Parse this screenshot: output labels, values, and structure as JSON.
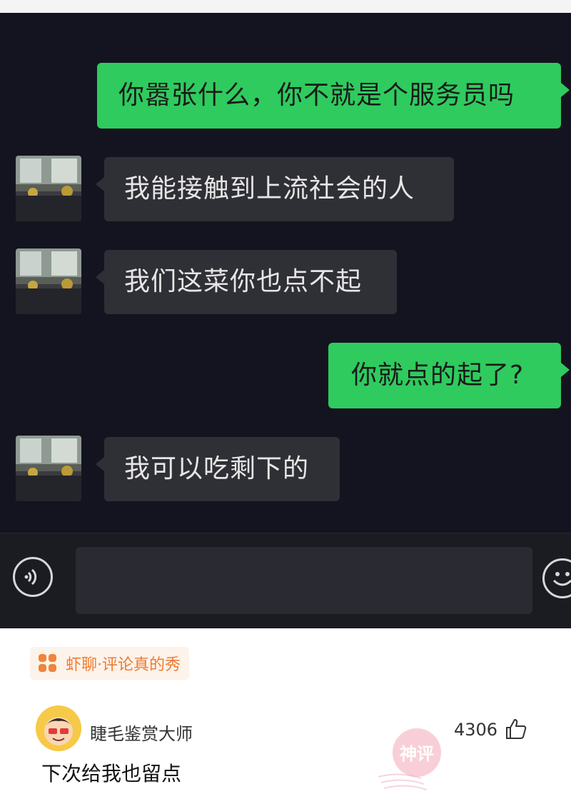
{
  "chat": {
    "messages": [
      {
        "side": "out",
        "text": "你嚣张什么，你不就是个服务员吗"
      },
      {
        "side": "in",
        "text": "我能接触到上流社会的人"
      },
      {
        "side": "in",
        "text": "我们这菜你也点不起"
      },
      {
        "side": "out",
        "text": "你就点的起了?"
      },
      {
        "side": "in",
        "text": "我可以吃剩下的"
      }
    ],
    "input": {
      "value": ""
    },
    "voice_icon": "voice-icon",
    "emoji_icon": "emoji-icon"
  },
  "source": {
    "icon": "app-logo-icon",
    "text": "虾聊·评论真的秀"
  },
  "comment": {
    "username": "睫毛鉴赏大师",
    "likes": "4306",
    "like_icon": "thumbs-up-icon",
    "text": "下次给我也留点",
    "badge": "神评"
  },
  "colors": {
    "chat_bg": "#141421",
    "outgoing_bubble": "#2fcb5e",
    "incoming_bubble": "#2f2f36",
    "source_text": "#ef7a32"
  }
}
